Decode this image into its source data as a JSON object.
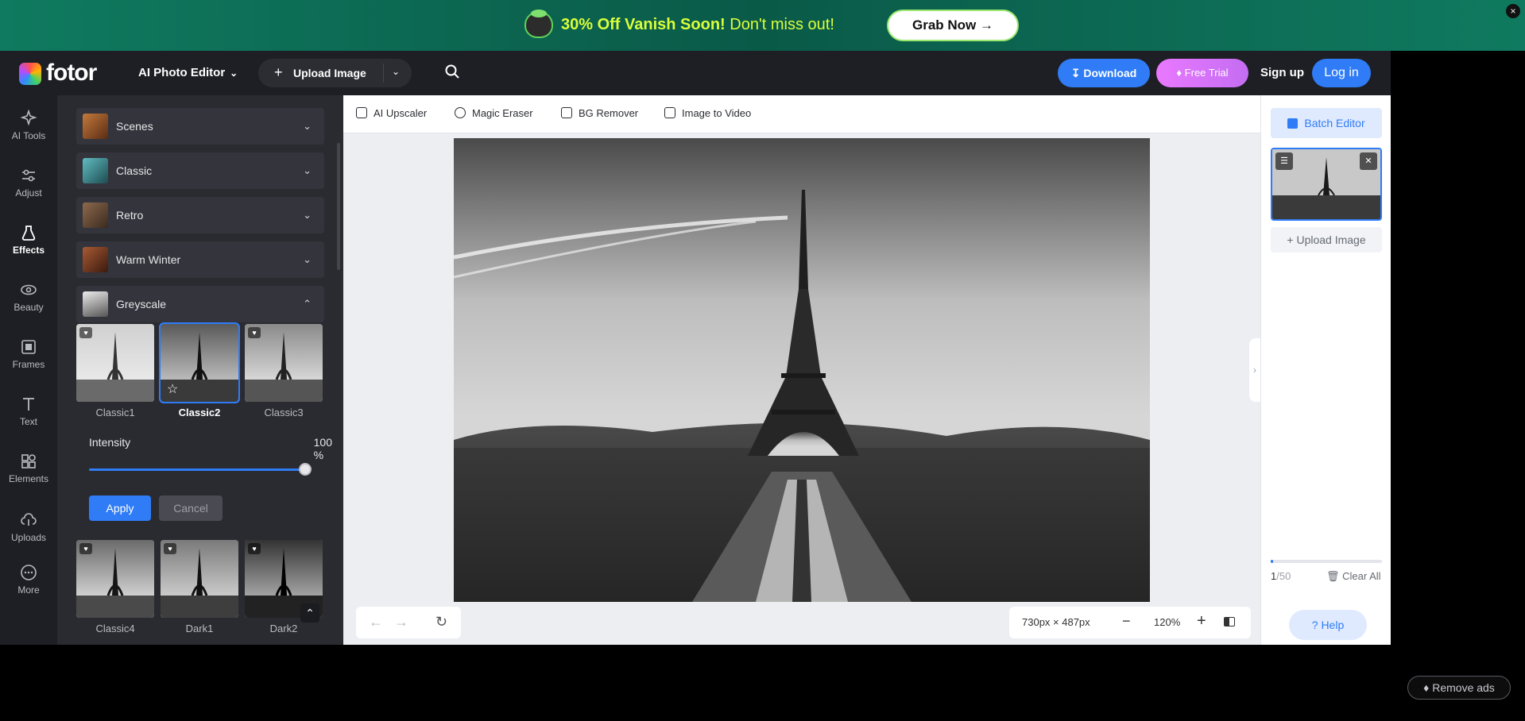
{
  "promo": {
    "title_strong": "30% Off Vanish Soon!",
    "title_rest": " Don't miss out!",
    "cta": "Grab Now →",
    "close": "×"
  },
  "header": {
    "logo": "fotor",
    "mode": "AI Photo Editor",
    "upload": "Upload Image",
    "download": "Download",
    "free_trial": "Free Trial",
    "sign_up": "Sign up",
    "log_in": "Log in"
  },
  "rail": [
    {
      "label": "AI Tools",
      "icon": "ai-tools-icon"
    },
    {
      "label": "Adjust",
      "icon": "adjust-icon"
    },
    {
      "label": "Effects",
      "icon": "effects-icon"
    },
    {
      "label": "Beauty",
      "icon": "beauty-icon"
    },
    {
      "label": "Frames",
      "icon": "frames-icon"
    },
    {
      "label": "Text",
      "icon": "text-icon"
    },
    {
      "label": "Elements",
      "icon": "elements-icon"
    },
    {
      "label": "Uploads",
      "icon": "uploads-icon"
    },
    {
      "label": "More",
      "icon": "more-icon"
    }
  ],
  "rail_active": "Effects",
  "effects": {
    "categories": [
      {
        "name": "Scenes",
        "color": "#a25a2e"
      },
      {
        "name": "Classic",
        "color": "#3a8b8f"
      },
      {
        "name": "Retro",
        "color": "#6b4a34"
      },
      {
        "name": "Warm Winter",
        "color": "#7a3b22"
      },
      {
        "name": "Greyscale",
        "color": "#9a9a9a"
      }
    ],
    "filters_row1": [
      "Classic1",
      "Classic2",
      "Classic3"
    ],
    "selected_filter": "Classic2",
    "intensity_label": "Intensity",
    "intensity_value": "100 %",
    "intensity_fraction": 1.0,
    "apply": "Apply",
    "cancel": "Cancel",
    "filters_row2": [
      "Classic4",
      "Dark1",
      "Dark2"
    ]
  },
  "toolbar": {
    "items": [
      "AI Upscaler",
      "Magic Eraser",
      "BG Remover",
      "Image to Video"
    ]
  },
  "canvas": {
    "dimensions": "730px × 487px",
    "zoom": "120%"
  },
  "right": {
    "batch_editor": "Batch Editor",
    "upload_image": "Upload Image",
    "count_current": "1",
    "count_total": "/50",
    "progress_fraction": 0.02,
    "clear_all": "Clear All",
    "help": "Help"
  },
  "remove_ads": "Remove ads",
  "colors": {
    "accent": "#2f7cf6",
    "promo_bg": "#0f7a5f",
    "promo_text": "#d8ff3a",
    "trial": "#d774fa"
  }
}
